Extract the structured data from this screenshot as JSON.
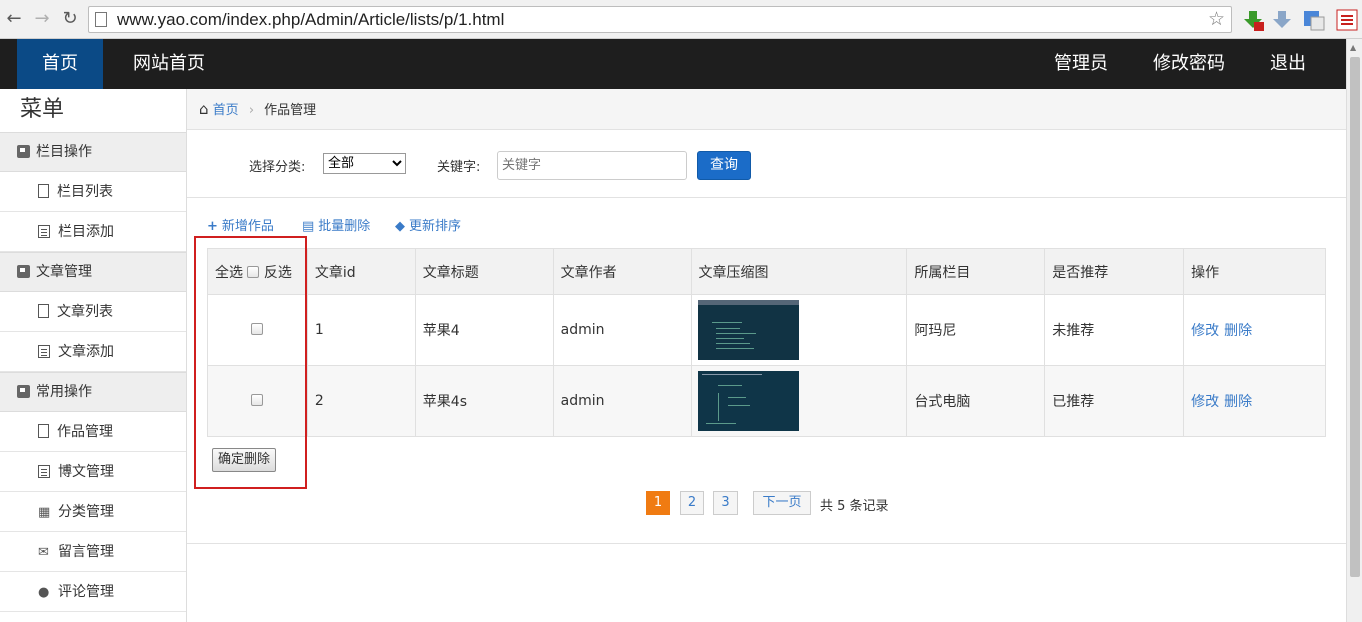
{
  "browser": {
    "url": "www.yao.com/index.php/Admin/Article/lists/p/1.html",
    "back_icon": "back-arrow-icon",
    "forward_icon": "forward-arrow-icon",
    "reload_icon": "reload-icon"
  },
  "topnav": {
    "home": "首页",
    "site_home": "网站首页",
    "admin": "管理员",
    "change_password": "修改密码",
    "logout": "退出"
  },
  "sidebar": {
    "title": "菜单",
    "groups": [
      {
        "label": "栏目操作",
        "items": [
          {
            "label": "栏目列表"
          },
          {
            "label": "栏目添加"
          }
        ]
      },
      {
        "label": "文章管理",
        "items": [
          {
            "label": "文章列表"
          },
          {
            "label": "文章添加"
          }
        ]
      },
      {
        "label": "常用操作",
        "items": [
          {
            "label": "作品管理"
          },
          {
            "label": "博文管理"
          },
          {
            "label": "分类管理"
          },
          {
            "label": "留言管理"
          },
          {
            "label": "评论管理"
          }
        ]
      }
    ]
  },
  "breadcrumb": {
    "home": "首页",
    "current": "作品管理"
  },
  "filter": {
    "category_label": "选择分类:",
    "category_value": "全部",
    "keyword_label": "关键字:",
    "keyword_placeholder": "关键字",
    "search_button": "查询"
  },
  "toolbar": {
    "add": "新增作品",
    "batch_delete": "批量删除",
    "update_sort": "更新排序"
  },
  "table": {
    "select_all": "全选",
    "invert": "反选",
    "headers": [
      "文章id",
      "文章标题",
      "文章作者",
      "文章压缩图",
      "所属栏目",
      "是否推荐",
      "操作"
    ],
    "rows": [
      {
        "id": "1",
        "title": "苹果4",
        "author": "admin",
        "category": "阿玛尼",
        "recommend": "未推荐",
        "edit": "修改",
        "delete": "删除"
      },
      {
        "id": "2",
        "title": "苹果4s",
        "author": "admin",
        "category": "台式电脑",
        "recommend": "已推荐",
        "edit": "修改",
        "delete": "删除"
      }
    ],
    "confirm_delete": "确定删除"
  },
  "pagination": {
    "pages": [
      "1",
      "2",
      "3"
    ],
    "current": "1",
    "next": "下一页",
    "total": "共 5 条记录"
  },
  "colors": {
    "accent": "#0b4a86",
    "link": "#3a7bc8",
    "pager_current": "#f07b12",
    "highlight_box": "#d01f1f"
  }
}
